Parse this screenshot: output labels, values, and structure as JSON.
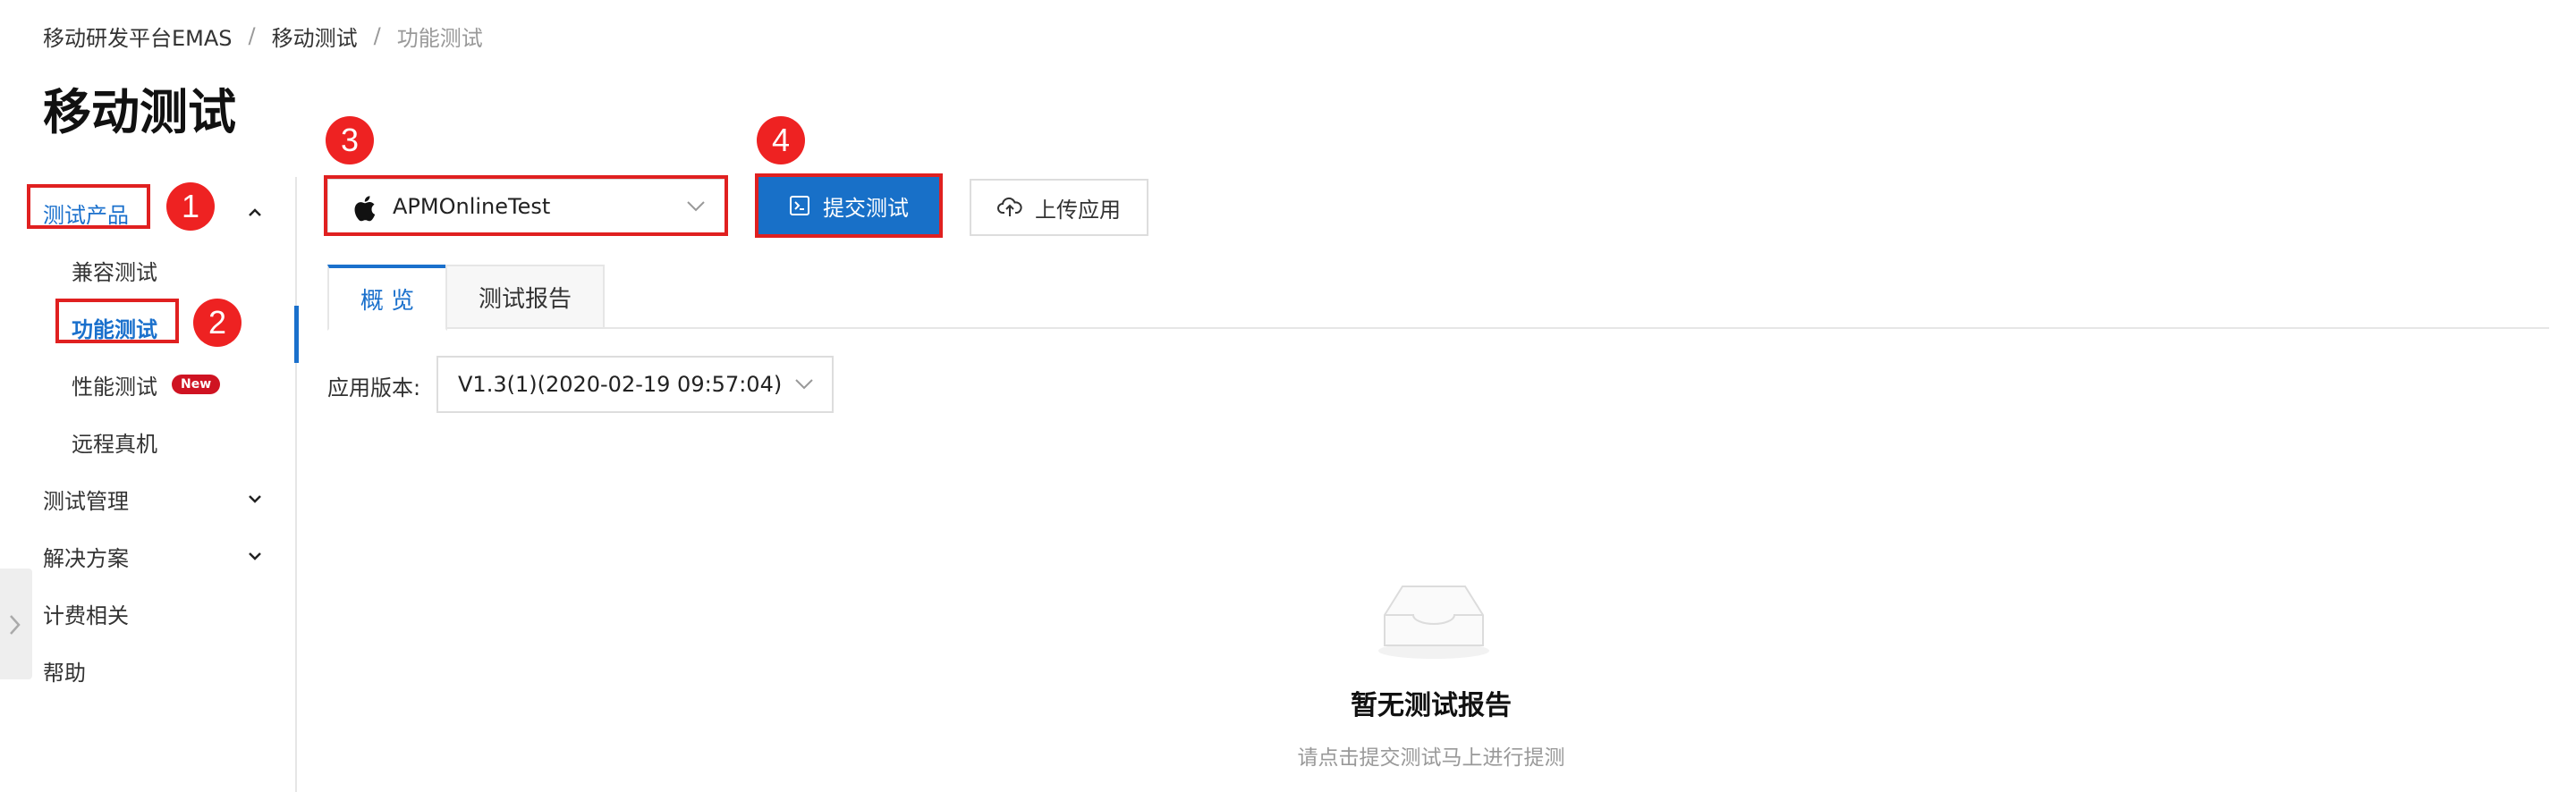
{
  "breadcrumb": {
    "items": [
      "移动研发平台EMAS",
      "移动测试",
      "功能测试"
    ],
    "separator": "/"
  },
  "page": {
    "title": "移动测试"
  },
  "sidebar": {
    "groups": [
      {
        "label": "测试产品",
        "expanded": true
      },
      {
        "label": "测试管理",
        "expanded": false
      },
      {
        "label": "解决方案",
        "expanded": false
      },
      {
        "label": "计费相关"
      },
      {
        "label": "帮助"
      }
    ],
    "sub_items": [
      {
        "label": "兼容测试"
      },
      {
        "label": "功能测试",
        "active": true
      },
      {
        "label": "性能测试",
        "badge": "New"
      },
      {
        "label": "远程真机"
      }
    ]
  },
  "annotations": [
    "1",
    "2",
    "3",
    "4"
  ],
  "toolbar": {
    "app_select_value": "APMOnlineTest",
    "submit_label": "提交测试",
    "upload_label": "上传应用"
  },
  "tabs": [
    {
      "label": "概 览",
      "active": true
    },
    {
      "label": "测试报告"
    }
  ],
  "version": {
    "label": "应用版本:",
    "value": "V1.3(1)(2020-02-19 09:57:04)"
  },
  "empty_state": {
    "title": "暂无测试报告",
    "subtitle": "请点击提交测试马上进行提测"
  },
  "colors": {
    "accent": "#1a70cc",
    "primary_button": "#1870c8",
    "callout_red": "#e02020",
    "badge_red": "#cf1322"
  }
}
